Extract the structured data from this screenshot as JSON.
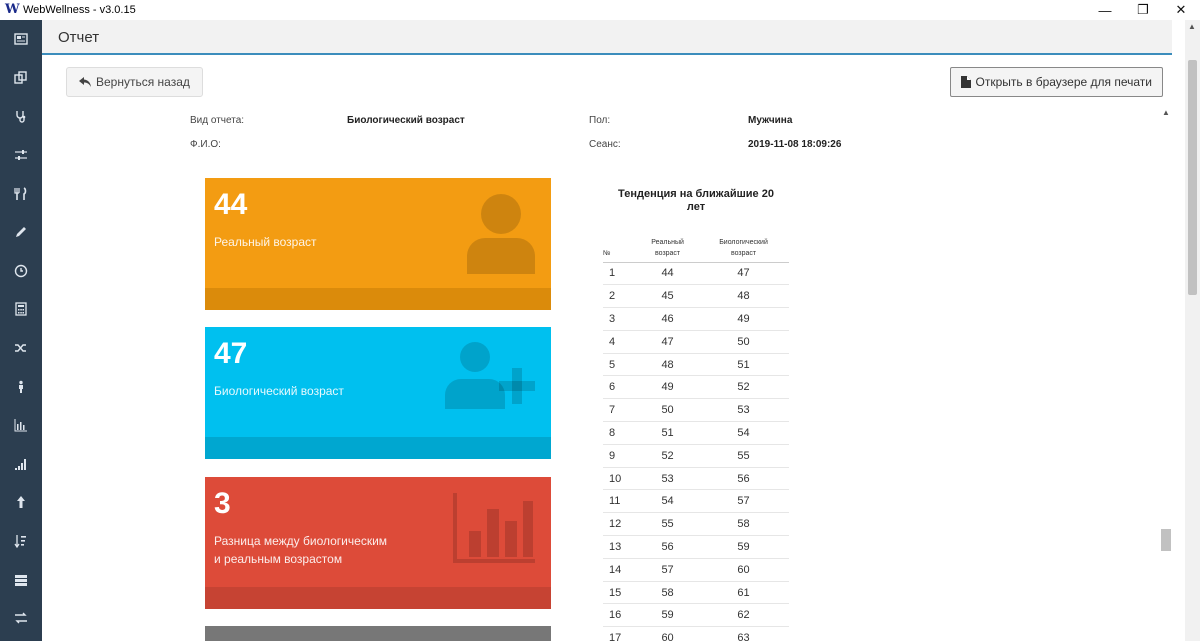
{
  "window": {
    "app_title": "WebWellness - v3.0.15",
    "logo_letter": "W"
  },
  "window_controls": {
    "minimize": "—",
    "restore": "❐",
    "close": "✕"
  },
  "page": {
    "title": "Отчет"
  },
  "toolbar": {
    "back_label": "Вернуться назад",
    "print_label": "Открыть в браузере для печати"
  },
  "sidebar": {
    "items": [
      {
        "icon": "newspaper-icon"
      },
      {
        "icon": "copy-icon"
      },
      {
        "icon": "stethoscope-icon"
      },
      {
        "icon": "sliders-icon"
      },
      {
        "icon": "cutlery-icon"
      },
      {
        "icon": "pencil-icon"
      },
      {
        "icon": "clock-icon"
      },
      {
        "icon": "calculator-icon"
      },
      {
        "icon": "shuffle-icon"
      },
      {
        "icon": "child-icon"
      },
      {
        "icon": "bar-chart-icon"
      },
      {
        "icon": "signal-icon"
      },
      {
        "icon": "arrow-up-icon"
      },
      {
        "icon": "sort-numeric-icon"
      },
      {
        "icon": "server-icon"
      },
      {
        "icon": "exchange-icon"
      }
    ]
  },
  "report_info": {
    "type_label": "Вид отчета:",
    "type_value": "Биологический возраст",
    "gender_label": "Пол:",
    "gender_value": "Мужчина",
    "name_label": "Ф.И.О:",
    "name_value": "",
    "session_label": "Сеанс:",
    "session_value": "2019-11-08 18:09:26"
  },
  "stats": {
    "real_age": {
      "value": "44",
      "label": "Реальный возраст",
      "color": "#f39c12"
    },
    "bio_age": {
      "value": "47",
      "label": "Биологический возраст",
      "color": "#00c0ef"
    },
    "diff": {
      "value": "3",
      "label_line1": "Разница между биологическим",
      "label_line2": "и реальным возрастом",
      "color": "#dd4b39"
    }
  },
  "trend": {
    "title_line1": "Тенденция на ближайшие 20",
    "title_line2": "лет",
    "col_no": "№",
    "col_real_line1": "Реальный",
    "col_real_line2": "возраст",
    "col_bio_line1": "Биологический",
    "col_bio_line2": "возраст",
    "rows": [
      [
        "1",
        "44",
        "47"
      ],
      [
        "2",
        "45",
        "48"
      ],
      [
        "3",
        "46",
        "49"
      ],
      [
        "4",
        "47",
        "50"
      ],
      [
        "5",
        "48",
        "51"
      ],
      [
        "6",
        "49",
        "52"
      ],
      [
        "7",
        "50",
        "53"
      ],
      [
        "8",
        "51",
        "54"
      ],
      [
        "9",
        "52",
        "55"
      ],
      [
        "10",
        "53",
        "56"
      ],
      [
        "11",
        "54",
        "57"
      ],
      [
        "12",
        "55",
        "58"
      ],
      [
        "13",
        "56",
        "59"
      ],
      [
        "14",
        "57",
        "60"
      ],
      [
        "15",
        "58",
        "61"
      ],
      [
        "16",
        "59",
        "62"
      ],
      [
        "17",
        "60",
        "63"
      ]
    ]
  }
}
